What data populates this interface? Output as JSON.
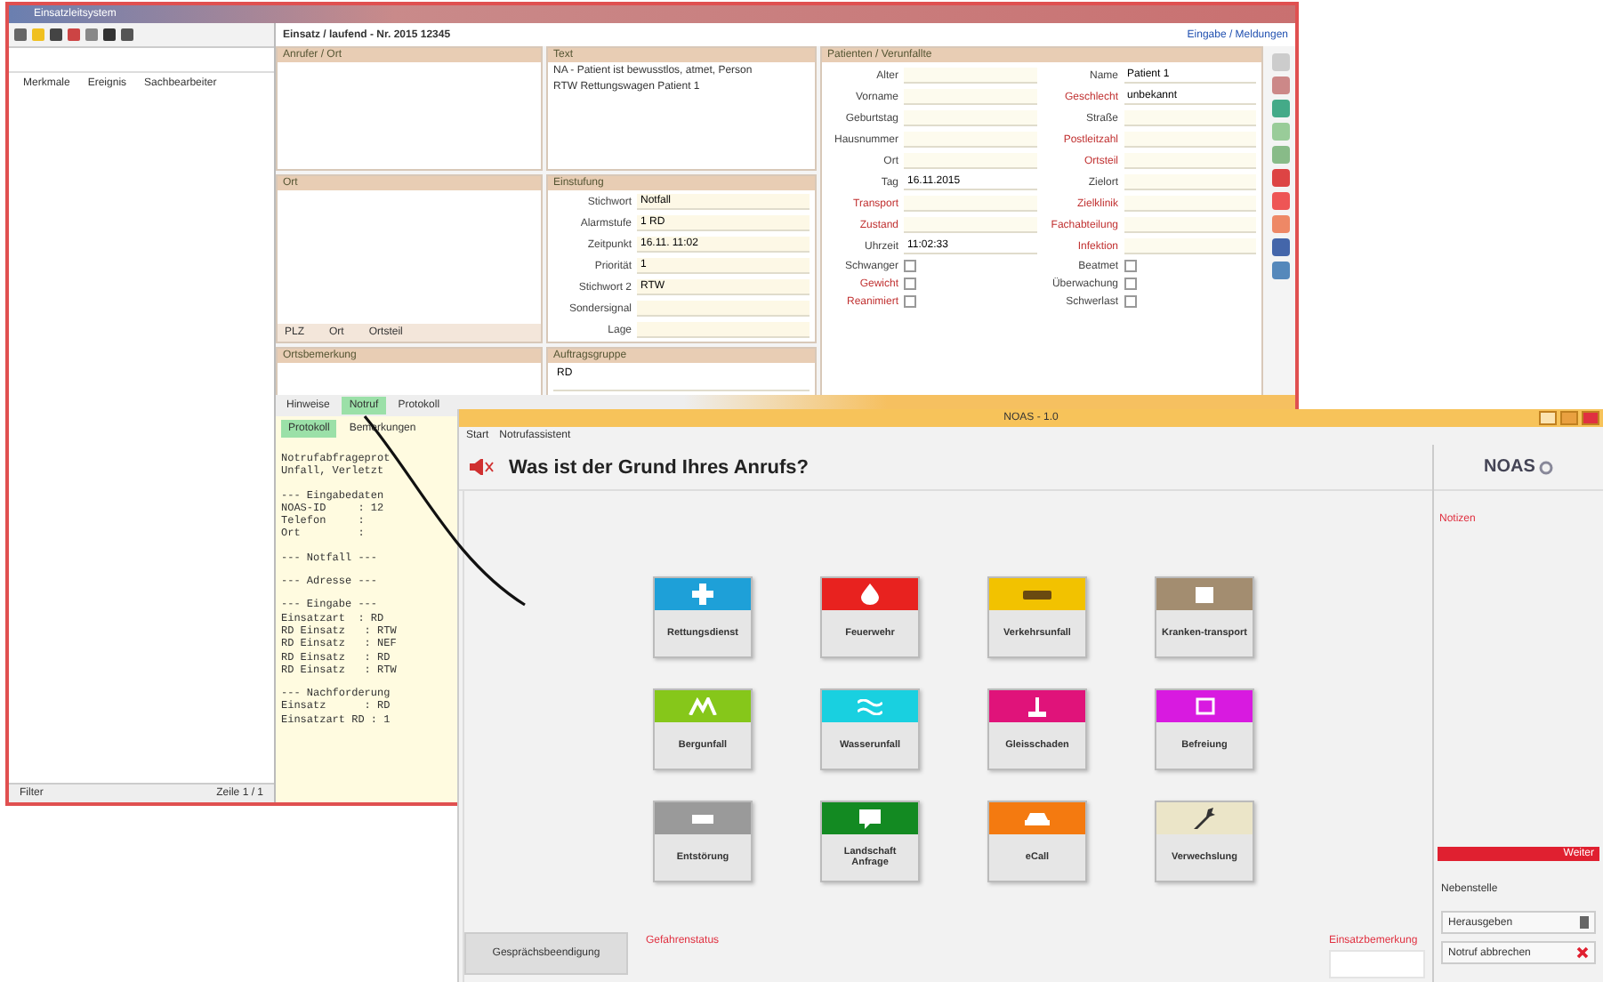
{
  "back_window": {
    "title": "Einsatzleitsystem",
    "list_columns": [
      "Merkmale",
      "Ereignis",
      "Sachbearbeiter"
    ],
    "list_footer": [
      "Filter",
      "Zeile 1 / 1"
    ],
    "incident_title": "Einsatz / laufend - Nr. 2015 12345",
    "header_link": "Eingabe / Meldungen",
    "caller_section": {
      "title": "Anrufer / Ort"
    },
    "location_section": {
      "title": "Ort",
      "footer": [
        "PLZ",
        "Ort",
        "Ortsteil"
      ]
    },
    "note_section": {
      "title": "Ortsbemerkung"
    },
    "text_section": {
      "title": "Text",
      "lines": [
        "NA - Patient ist bewusstlos, atmet, Person",
        "RTW Rettungswagen Patient 1"
      ]
    },
    "rating_section": {
      "title": "Einstufung",
      "fields": [
        {
          "label": "Stichwort",
          "value": "Notfall"
        },
        {
          "label": "Alarmstufe",
          "value": "1 RD"
        },
        {
          "label": "Zeitpunkt",
          "value": "16.11. 11:02"
        },
        {
          "label": "Priorität",
          "value": "1"
        },
        {
          "label": "Stichwort 2",
          "value": "RTW"
        },
        {
          "label": "Sondersignal"
        },
        {
          "label": "Lage"
        }
      ]
    },
    "group_section": {
      "title": "Auftragsgruppe",
      "value": "RD"
    },
    "patient_section": {
      "title": "Patienten / Verunfallte",
      "fields": [
        {
          "label": "Alter",
          "required": false
        },
        {
          "label": "Name",
          "value": "Patient 1",
          "required": false
        },
        {
          "label": "Vorname",
          "required": false
        },
        {
          "label": "Geschlecht",
          "value": "unbekannt",
          "required": true
        },
        {
          "label": "Geburtstag",
          "required": false
        },
        {
          "label": "Straße",
          "required": false
        },
        {
          "label": "Hausnummer",
          "required": false
        },
        {
          "label": "Postleitzahl",
          "required": true
        },
        {
          "label": "Ort",
          "required": false
        },
        {
          "label": "Ortsteil",
          "required": true
        },
        {
          "label": "Tag",
          "value": "16.11.2015",
          "required": false
        },
        {
          "label": "Zielort",
          "required": false
        },
        {
          "label": "Transport",
          "required": true
        },
        {
          "label": "Zielklinik",
          "required": true
        },
        {
          "label": "Zustand",
          "required": true
        },
        {
          "label": "Fachabteilung",
          "required": true
        },
        {
          "label": "Uhrzeit",
          "value": "11:02:33",
          "required": false
        },
        {
          "label": "Infektion",
          "required": true
        }
      ],
      "checks": [
        {
          "label": "Schwanger",
          "checked": false,
          "required": false
        },
        {
          "label": "Beatmet",
          "checked": false,
          "required": false
        },
        {
          "label": "Gewicht",
          "checked": false,
          "required": true
        },
        {
          "label": "Überwachung",
          "checked": false,
          "required": false
        },
        {
          "label": "Reanimiert",
          "checked": false,
          "required": true
        },
        {
          "label": "Schwerlast",
          "checked": false,
          "required": false
        }
      ]
    },
    "tabs": [
      {
        "label": "Hinweise",
        "selected": false
      },
      {
        "label": "Notruf",
        "selected": true
      },
      {
        "label": "Protokoll",
        "selected": false
      }
    ],
    "sub_tabs": [
      {
        "label": "Protokoll",
        "selected": true
      },
      {
        "label": "Bemerkungen",
        "selected": false
      }
    ],
    "log_blocks": [
      [
        "Notrufabfrageprot",
        "Unfall, Verletzt"
      ],
      [
        "--- Eingabedaten",
        "NOAS-ID     : 12",
        "Telefon     :",
        "Ort         :"
      ],
      [
        "--- Notfall ---"
      ],
      [
        "--- Adresse ---"
      ],
      [
        "--- Eingabe ---",
        "Einsatzart  : RD",
        "RD Einsatz   : RTW",
        "RD Einsatz   : NEF",
        "RD Einsatz   : RD",
        "RD Einsatz   : RTW"
      ],
      [
        "--- Nachforderung",
        "Einsatz      : RD",
        "Einsatzart RD : 1"
      ]
    ]
  },
  "front_window": {
    "title": "NOAS - 1.0",
    "breadcrumb": [
      "Start",
      "Notrufassistent"
    ],
    "question": "Was ist der Grund Ihres Anrufs?",
    "logo": "NOAS",
    "tiles": [
      {
        "label": "Rettungsdienst",
        "color": "#1ea0d8"
      },
      {
        "label": "Feuerwehr",
        "color": "#e8221f"
      },
      {
        "label": "Verkehrsunfall",
        "color": "#f2c200"
      },
      {
        "label": "Kranken-transport",
        "color": "#a38d70"
      },
      {
        "label": "Bergunfall",
        "color": "#86c71a"
      },
      {
        "label": "Wasserunfall",
        "color": "#19d0e0"
      },
      {
        "label": "Gleisschaden",
        "color": "#e0137a"
      },
      {
        "label": "Befreiung",
        "color": "#d81ae0"
      },
      {
        "label": "Entstörung",
        "color": "#9a9a9a"
      },
      {
        "label": "Landschaft Anfrage",
        "color": "#138a22"
      },
      {
        "label": "eCall",
        "color": "#f47a10"
      },
      {
        "label": "Verwechslung",
        "color": "#ebe5c8"
      }
    ],
    "notes_label": "Notizen",
    "danger_label": "Gefahrenstatus",
    "remark_label": "Einsatzbemerkung",
    "end_button": "Gesprächsbeendigung",
    "red_bar": "Weiter",
    "extension_label": "Nebenstelle",
    "side_buttons": [
      "Herausgeben",
      "Notruf abbrechen"
    ]
  }
}
